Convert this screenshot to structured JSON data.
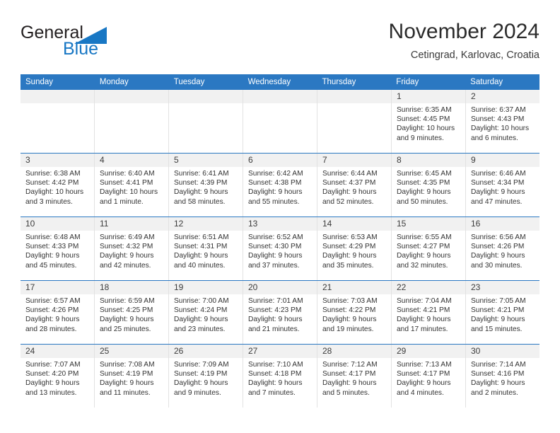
{
  "brand": {
    "name_part1": "General",
    "name_part2": "Blue",
    "triangle_color": "#1877c4",
    "text_color": "#231f20"
  },
  "header": {
    "title": "November 2024",
    "subtitle": "Cetingrad, Karlovac, Croatia"
  },
  "theme": {
    "header_blue": "#2b78c2",
    "day_band_gray": "#f1f1f1",
    "grid_line": "#e2e2e2"
  },
  "calendar": {
    "weekdays": [
      "Sunday",
      "Monday",
      "Tuesday",
      "Wednesday",
      "Thursday",
      "Friday",
      "Saturday"
    ],
    "weeks": [
      [
        {
          "day": "",
          "sunrise": "",
          "sunset": "",
          "daylight1": "",
          "daylight2": "",
          "empty": true
        },
        {
          "day": "",
          "sunrise": "",
          "sunset": "",
          "daylight1": "",
          "daylight2": "",
          "empty": true
        },
        {
          "day": "",
          "sunrise": "",
          "sunset": "",
          "daylight1": "",
          "daylight2": "",
          "empty": true
        },
        {
          "day": "",
          "sunrise": "",
          "sunset": "",
          "daylight1": "",
          "daylight2": "",
          "empty": true
        },
        {
          "day": "",
          "sunrise": "",
          "sunset": "",
          "daylight1": "",
          "daylight2": "",
          "empty": true
        },
        {
          "day": "1",
          "sunrise": "Sunrise: 6:35 AM",
          "sunset": "Sunset: 4:45 PM",
          "daylight1": "Daylight: 10 hours",
          "daylight2": "and 9 minutes.",
          "empty": false
        },
        {
          "day": "2",
          "sunrise": "Sunrise: 6:37 AM",
          "sunset": "Sunset: 4:43 PM",
          "daylight1": "Daylight: 10 hours",
          "daylight2": "and 6 minutes.",
          "empty": false
        }
      ],
      [
        {
          "day": "3",
          "sunrise": "Sunrise: 6:38 AM",
          "sunset": "Sunset: 4:42 PM",
          "daylight1": "Daylight: 10 hours",
          "daylight2": "and 3 minutes.",
          "empty": false
        },
        {
          "day": "4",
          "sunrise": "Sunrise: 6:40 AM",
          "sunset": "Sunset: 4:41 PM",
          "daylight1": "Daylight: 10 hours",
          "daylight2": "and 1 minute.",
          "empty": false
        },
        {
          "day": "5",
          "sunrise": "Sunrise: 6:41 AM",
          "sunset": "Sunset: 4:39 PM",
          "daylight1": "Daylight: 9 hours",
          "daylight2": "and 58 minutes.",
          "empty": false
        },
        {
          "day": "6",
          "sunrise": "Sunrise: 6:42 AM",
          "sunset": "Sunset: 4:38 PM",
          "daylight1": "Daylight: 9 hours",
          "daylight2": "and 55 minutes.",
          "empty": false
        },
        {
          "day": "7",
          "sunrise": "Sunrise: 6:44 AM",
          "sunset": "Sunset: 4:37 PM",
          "daylight1": "Daylight: 9 hours",
          "daylight2": "and 52 minutes.",
          "empty": false
        },
        {
          "day": "8",
          "sunrise": "Sunrise: 6:45 AM",
          "sunset": "Sunset: 4:35 PM",
          "daylight1": "Daylight: 9 hours",
          "daylight2": "and 50 minutes.",
          "empty": false
        },
        {
          "day": "9",
          "sunrise": "Sunrise: 6:46 AM",
          "sunset": "Sunset: 4:34 PM",
          "daylight1": "Daylight: 9 hours",
          "daylight2": "and 47 minutes.",
          "empty": false
        }
      ],
      [
        {
          "day": "10",
          "sunrise": "Sunrise: 6:48 AM",
          "sunset": "Sunset: 4:33 PM",
          "daylight1": "Daylight: 9 hours",
          "daylight2": "and 45 minutes.",
          "empty": false
        },
        {
          "day": "11",
          "sunrise": "Sunrise: 6:49 AM",
          "sunset": "Sunset: 4:32 PM",
          "daylight1": "Daylight: 9 hours",
          "daylight2": "and 42 minutes.",
          "empty": false
        },
        {
          "day": "12",
          "sunrise": "Sunrise: 6:51 AM",
          "sunset": "Sunset: 4:31 PM",
          "daylight1": "Daylight: 9 hours",
          "daylight2": "and 40 minutes.",
          "empty": false
        },
        {
          "day": "13",
          "sunrise": "Sunrise: 6:52 AM",
          "sunset": "Sunset: 4:30 PM",
          "daylight1": "Daylight: 9 hours",
          "daylight2": "and 37 minutes.",
          "empty": false
        },
        {
          "day": "14",
          "sunrise": "Sunrise: 6:53 AM",
          "sunset": "Sunset: 4:29 PM",
          "daylight1": "Daylight: 9 hours",
          "daylight2": "and 35 minutes.",
          "empty": false
        },
        {
          "day": "15",
          "sunrise": "Sunrise: 6:55 AM",
          "sunset": "Sunset: 4:27 PM",
          "daylight1": "Daylight: 9 hours",
          "daylight2": "and 32 minutes.",
          "empty": false
        },
        {
          "day": "16",
          "sunrise": "Sunrise: 6:56 AM",
          "sunset": "Sunset: 4:26 PM",
          "daylight1": "Daylight: 9 hours",
          "daylight2": "and 30 minutes.",
          "empty": false
        }
      ],
      [
        {
          "day": "17",
          "sunrise": "Sunrise: 6:57 AM",
          "sunset": "Sunset: 4:26 PM",
          "daylight1": "Daylight: 9 hours",
          "daylight2": "and 28 minutes.",
          "empty": false
        },
        {
          "day": "18",
          "sunrise": "Sunrise: 6:59 AM",
          "sunset": "Sunset: 4:25 PM",
          "daylight1": "Daylight: 9 hours",
          "daylight2": "and 25 minutes.",
          "empty": false
        },
        {
          "day": "19",
          "sunrise": "Sunrise: 7:00 AM",
          "sunset": "Sunset: 4:24 PM",
          "daylight1": "Daylight: 9 hours",
          "daylight2": "and 23 minutes.",
          "empty": false
        },
        {
          "day": "20",
          "sunrise": "Sunrise: 7:01 AM",
          "sunset": "Sunset: 4:23 PM",
          "daylight1": "Daylight: 9 hours",
          "daylight2": "and 21 minutes.",
          "empty": false
        },
        {
          "day": "21",
          "sunrise": "Sunrise: 7:03 AM",
          "sunset": "Sunset: 4:22 PM",
          "daylight1": "Daylight: 9 hours",
          "daylight2": "and 19 minutes.",
          "empty": false
        },
        {
          "day": "22",
          "sunrise": "Sunrise: 7:04 AM",
          "sunset": "Sunset: 4:21 PM",
          "daylight1": "Daylight: 9 hours",
          "daylight2": "and 17 minutes.",
          "empty": false
        },
        {
          "day": "23",
          "sunrise": "Sunrise: 7:05 AM",
          "sunset": "Sunset: 4:21 PM",
          "daylight1": "Daylight: 9 hours",
          "daylight2": "and 15 minutes.",
          "empty": false
        }
      ],
      [
        {
          "day": "24",
          "sunrise": "Sunrise: 7:07 AM",
          "sunset": "Sunset: 4:20 PM",
          "daylight1": "Daylight: 9 hours",
          "daylight2": "and 13 minutes.",
          "empty": false
        },
        {
          "day": "25",
          "sunrise": "Sunrise: 7:08 AM",
          "sunset": "Sunset: 4:19 PM",
          "daylight1": "Daylight: 9 hours",
          "daylight2": "and 11 minutes.",
          "empty": false
        },
        {
          "day": "26",
          "sunrise": "Sunrise: 7:09 AM",
          "sunset": "Sunset: 4:19 PM",
          "daylight1": "Daylight: 9 hours",
          "daylight2": "and 9 minutes.",
          "empty": false
        },
        {
          "day": "27",
          "sunrise": "Sunrise: 7:10 AM",
          "sunset": "Sunset: 4:18 PM",
          "daylight1": "Daylight: 9 hours",
          "daylight2": "and 7 minutes.",
          "empty": false
        },
        {
          "day": "28",
          "sunrise": "Sunrise: 7:12 AM",
          "sunset": "Sunset: 4:17 PM",
          "daylight1": "Daylight: 9 hours",
          "daylight2": "and 5 minutes.",
          "empty": false
        },
        {
          "day": "29",
          "sunrise": "Sunrise: 7:13 AM",
          "sunset": "Sunset: 4:17 PM",
          "daylight1": "Daylight: 9 hours",
          "daylight2": "and 4 minutes.",
          "empty": false
        },
        {
          "day": "30",
          "sunrise": "Sunrise: 7:14 AM",
          "sunset": "Sunset: 4:16 PM",
          "daylight1": "Daylight: 9 hours",
          "daylight2": "and 2 minutes.",
          "empty": false
        }
      ]
    ]
  }
}
